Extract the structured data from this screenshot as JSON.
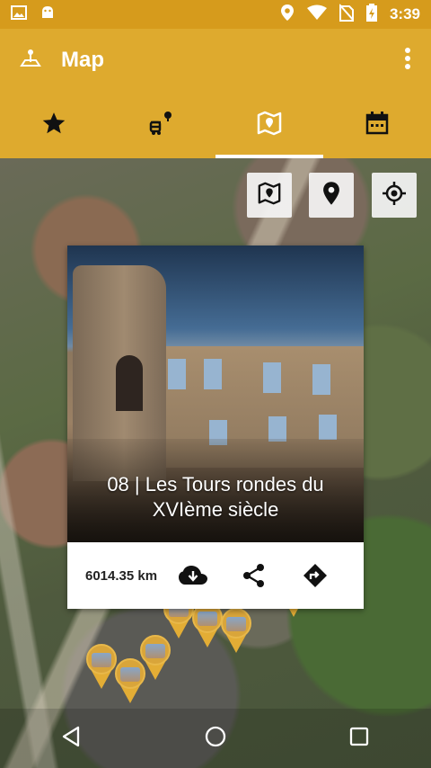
{
  "status_bar": {
    "time": "3:39",
    "icons": [
      "image-icon",
      "android-icon",
      "location-icon",
      "wifi-icon",
      "no-sim-icon",
      "battery-charging-icon"
    ]
  },
  "app_bar": {
    "title": "Map",
    "logo_icon": "map-pin-base-icon",
    "menu_icon": "more-vertical-icon"
  },
  "tabs": [
    {
      "name": "favorites",
      "icon": "star-icon",
      "active": false
    },
    {
      "name": "routes",
      "icon": "route-icon",
      "active": false
    },
    {
      "name": "map",
      "icon": "map-icon",
      "active": true
    },
    {
      "name": "calendar",
      "icon": "calendar-icon",
      "active": false
    }
  ],
  "map_controls": [
    "map-layers-icon",
    "place-pin-icon",
    "my-location-icon"
  ],
  "poi_card": {
    "title": "08 | Les Tours rondes du XVIème siècle",
    "distance": "6014.35 km",
    "actions": [
      "download-icon",
      "share-icon",
      "directions-icon"
    ]
  },
  "colors": {
    "primary": "#deaa2e",
    "status_bar": "#d69b1c",
    "active_indicator": "#ffffff",
    "pin": "#e3ad35"
  },
  "nav_bar": [
    "back-icon",
    "home-icon",
    "recents-icon"
  ]
}
